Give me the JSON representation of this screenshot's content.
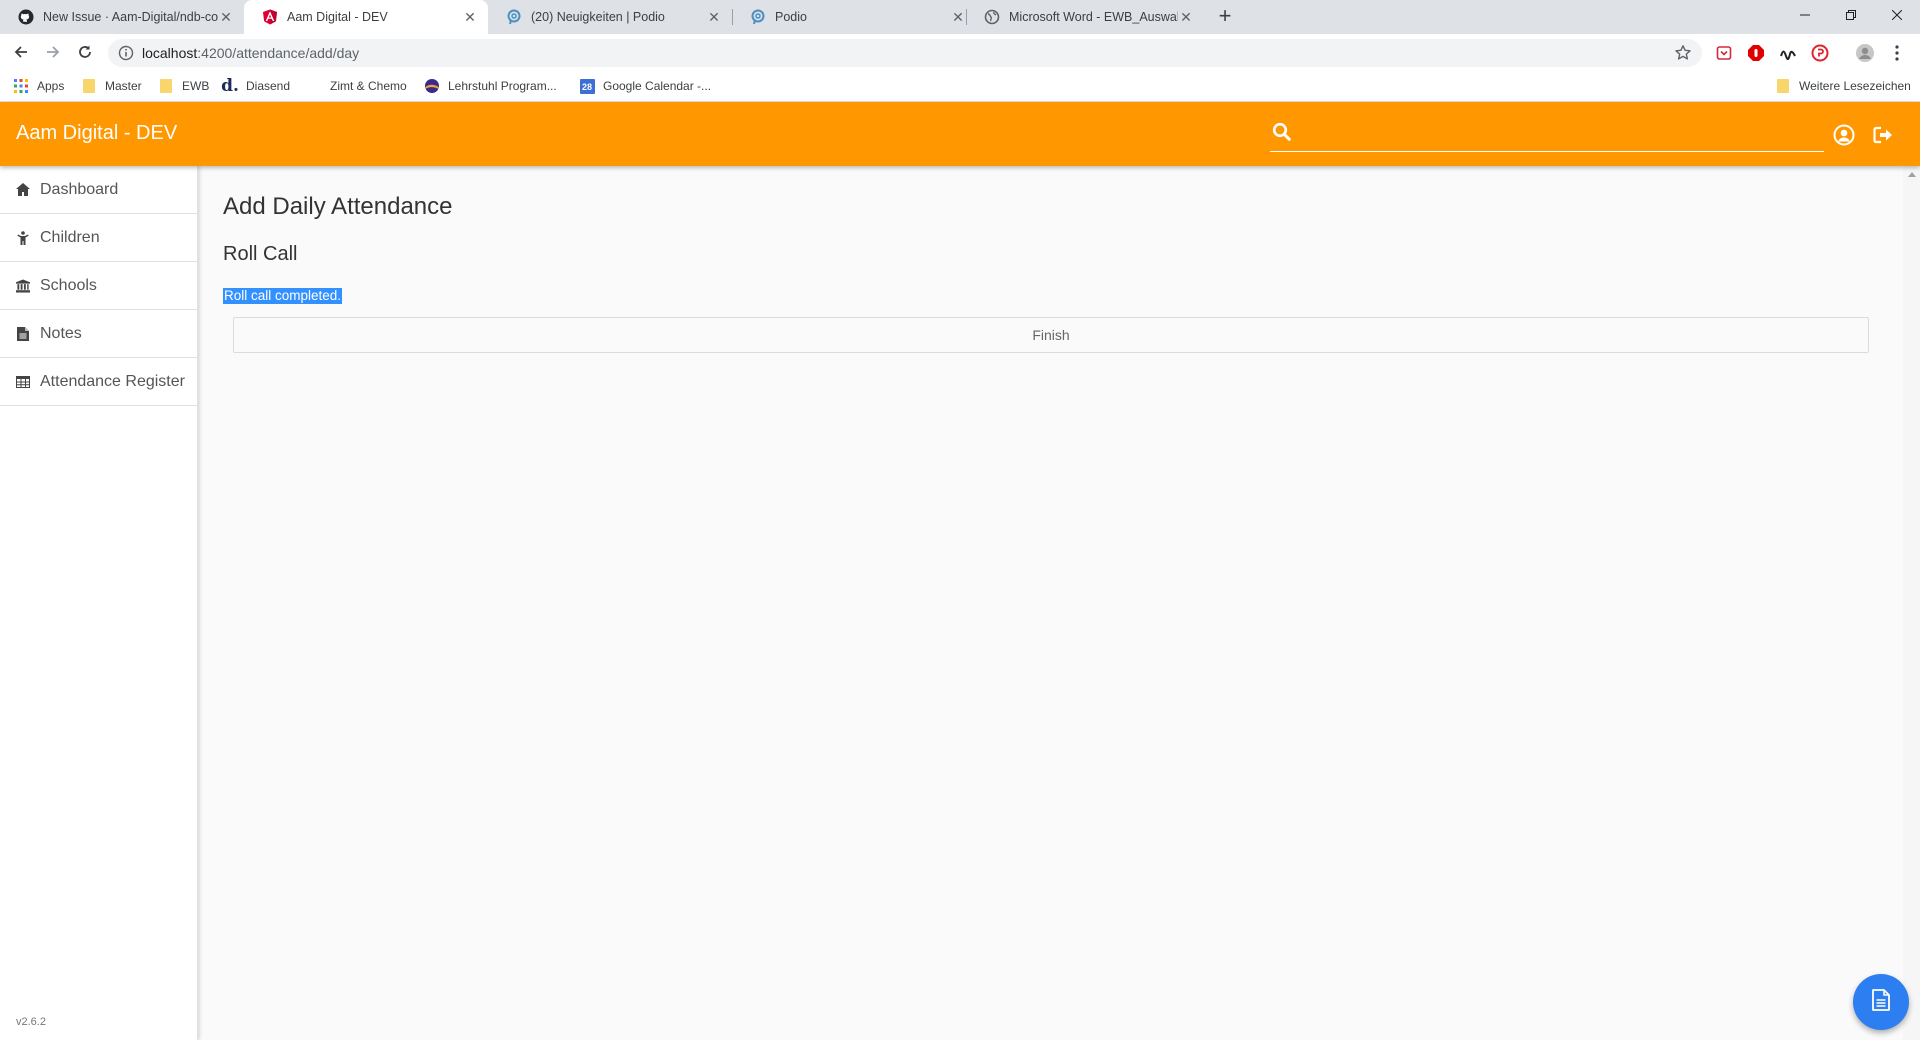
{
  "browser": {
    "tabs": [
      {
        "title": "New Issue · Aam-Digital/ndb-cor",
        "icon": "github-icon",
        "active": false
      },
      {
        "title": "Aam Digital - DEV",
        "icon": "angular-icon",
        "active": true
      },
      {
        "title": "(20) Neuigkeiten | Podio",
        "icon": "podio-icon",
        "active": false
      },
      {
        "title": "Podio",
        "icon": "podio-icon",
        "active": false
      },
      {
        "title": "Microsoft Word - EWB_Auswahl (",
        "icon": "globe-icon",
        "active": false
      }
    ],
    "url_host": "localhost",
    "url_path": ":4200/attendance/add/day",
    "bookmarks": [
      {
        "label": "Apps",
        "icon": "apps-grid-icon"
      },
      {
        "label": "Master",
        "icon": "folder-icon"
      },
      {
        "label": "EWB",
        "icon": "folder-icon"
      },
      {
        "label": "Diasend",
        "icon": "diasend-icon"
      },
      {
        "label": "Zimt & Chemo",
        "icon": "blank-icon"
      },
      {
        "label": "Lehrstuhl Program...",
        "icon": "lehrstuhl-icon"
      },
      {
        "label": "Google Calendar -...",
        "icon": "calendar-icon"
      }
    ],
    "other_bookmarks": "Weitere Lesezeichen",
    "calendar_day": "28",
    "diasend_glyph": "d."
  },
  "app": {
    "title": "Aam Digital - DEV",
    "search_placeholder": "",
    "accent_color": "#ff9800",
    "version": "v2.6.2"
  },
  "sidenav": {
    "items": [
      {
        "label": "Dashboard",
        "icon": "home-icon"
      },
      {
        "label": "Children",
        "icon": "child-icon"
      },
      {
        "label": "Schools",
        "icon": "university-icon"
      },
      {
        "label": "Notes",
        "icon": "file-text-icon"
      },
      {
        "label": "Attendance Register",
        "icon": "table-icon"
      }
    ]
  },
  "main": {
    "title": "Add Daily Attendance",
    "subtitle": "Roll Call",
    "status": "Roll call completed.",
    "finish_label": "Finish"
  }
}
